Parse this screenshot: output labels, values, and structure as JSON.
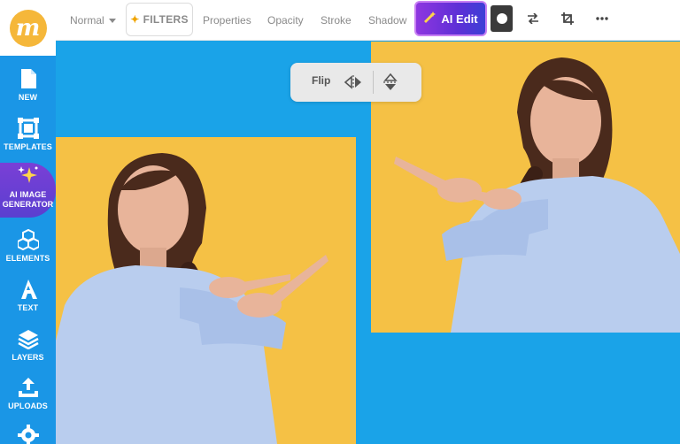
{
  "logo": {
    "letter": "m"
  },
  "sidebar": {
    "items": [
      {
        "label": "NEW",
        "icon": "document-icon"
      },
      {
        "label": "TEMPLATES",
        "icon": "templates-icon"
      },
      {
        "label": "AI IMAGE GENERATOR",
        "line1": "AI IMAGE",
        "line2": "GENERATOR",
        "icon": "sparkles-icon"
      },
      {
        "label": "ELEMENTS",
        "icon": "cubes-icon"
      },
      {
        "label": "TEXT",
        "icon": "text-icon"
      },
      {
        "label": "LAYERS",
        "icon": "layers-icon"
      },
      {
        "label": "UPLOADS",
        "icon": "upload-icon"
      },
      {
        "label": "",
        "icon": "gear-icon"
      }
    ]
  },
  "toolbar": {
    "blend_mode": "Normal",
    "filters": "FILTERS",
    "properties": "Properties",
    "opacity": "Opacity",
    "stroke": "Stroke",
    "shadow": "Shadow",
    "ai_edit": "AI Edit"
  },
  "flip_popover": {
    "label": "Flip"
  },
  "colors": {
    "canvas_bg": "#1aa3e8",
    "sidebar_bg": "#1a96e6",
    "photo_bg": "#f5c145",
    "ai_gradient_start": "#8e36e0",
    "ai_gradient_end": "#3c3fd6",
    "logo_bg": "#f5b73a"
  }
}
